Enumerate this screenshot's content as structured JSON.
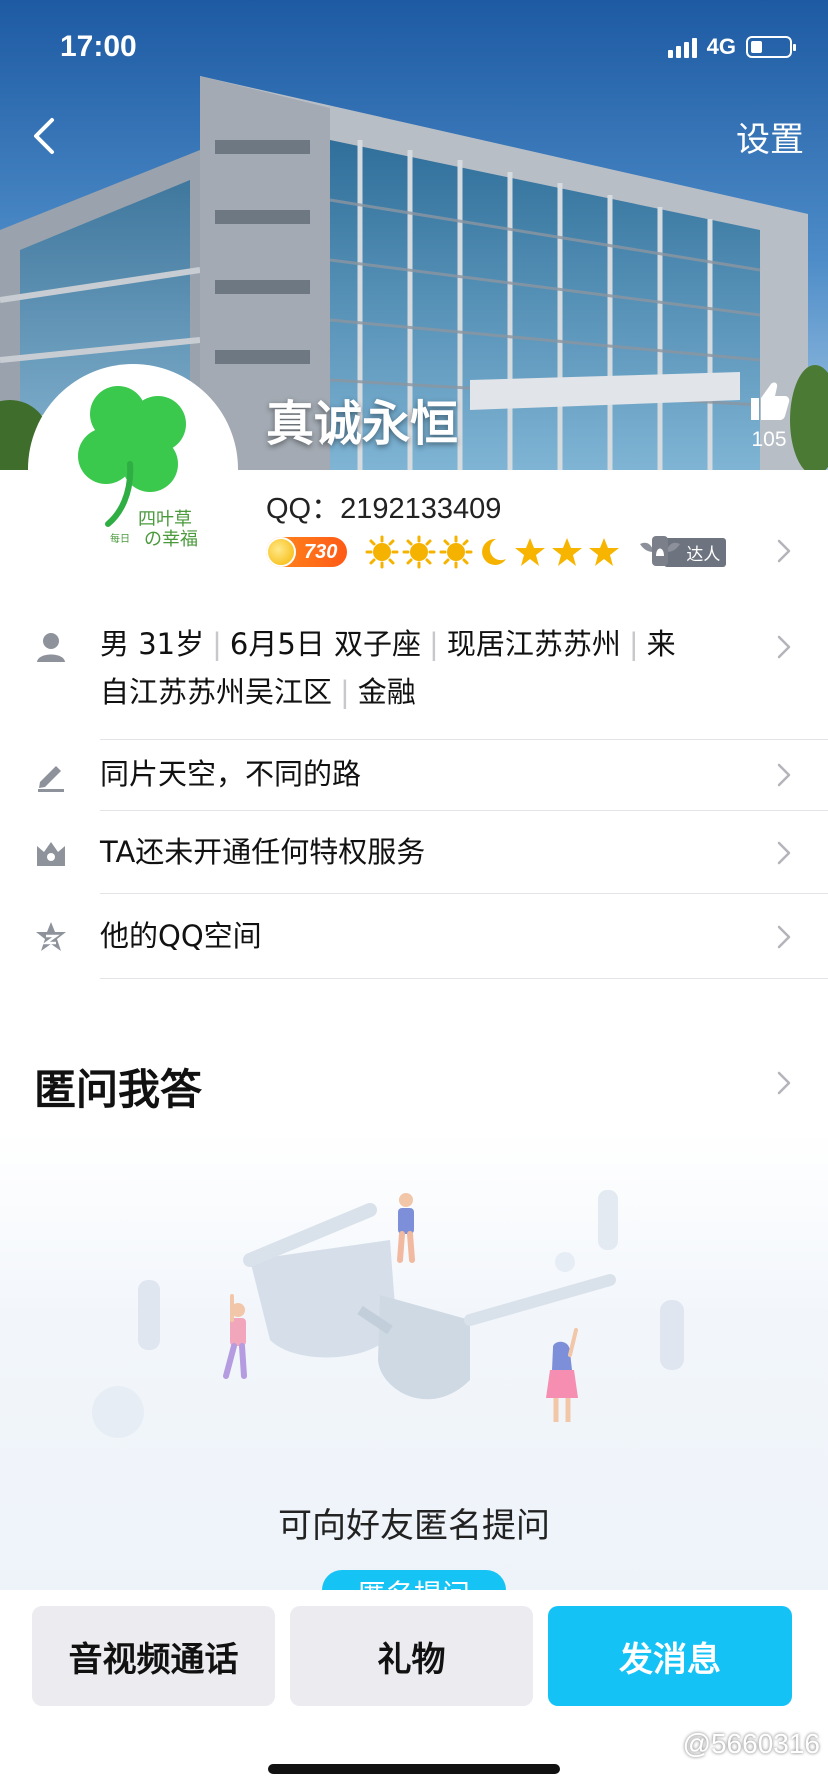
{
  "status_bar": {
    "time": "17:00",
    "network": "4G",
    "battery_level": 0.3
  },
  "header": {
    "settings_label": "设置",
    "nickname": "真诚永恒",
    "like_count": "105"
  },
  "avatar": {
    "icon": "four-leaf-clover-avatar",
    "caption_line1": "四叶草",
    "caption_line2": "の幸福",
    "caption_small": "每日"
  },
  "profile": {
    "qq_label": "QQ：2192133409",
    "coin_value": "730",
    "level_icons": [
      "sun",
      "sun",
      "sun",
      "moon",
      "star",
      "star",
      "star"
    ],
    "talent_label": "达人"
  },
  "info": {
    "basic_parts": [
      "男 31岁",
      "6月5日 双子座",
      "现居江苏苏州",
      "来"
    ],
    "basic_line2_parts": [
      "自江苏苏州吴江区",
      "金融"
    ],
    "signature": "同片天空，不同的路",
    "privilege": "TA还未开通任何特权服务",
    "qzone": "他的QQ空间"
  },
  "qa": {
    "title": "匿问我答",
    "caption": "可向好友匿名提问",
    "button_label": "匿名提问"
  },
  "bottom_bar": {
    "call_label": "音视频通话",
    "gift_label": "礼物",
    "message_label": "发消息"
  },
  "watermark": "@5660316",
  "colors": {
    "accent": "#14c2f6",
    "coin": "#ff6a1a",
    "divider": "#e4e4e8"
  }
}
